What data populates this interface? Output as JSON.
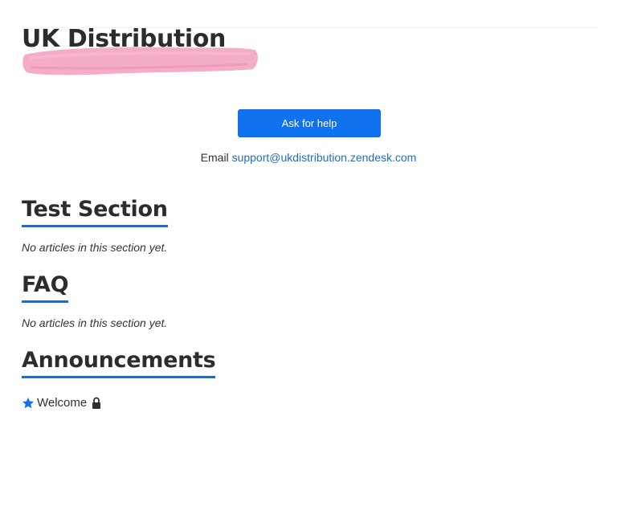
{
  "brand": {
    "title": "UK Distribution",
    "brush_color": "#f29fc0"
  },
  "help": {
    "ask_button_label": "Ask for help",
    "email_prefix": "Email",
    "email_address": "support@ukdistribution.zendesk.com"
  },
  "sections": [
    {
      "title": "Test Section",
      "empty_text": "No articles in this section yet."
    },
    {
      "title": "FAQ",
      "empty_text": "No articles in this section yet."
    },
    {
      "title": "Announcements",
      "articles": [
        {
          "title": "Welcome",
          "promoted_icon": "star-icon",
          "restricted_icon": "lock-icon"
        }
      ]
    }
  ],
  "colors": {
    "accent": "#1072ee",
    "link": "#1b6fbd",
    "underline": "#1b6fbd"
  }
}
